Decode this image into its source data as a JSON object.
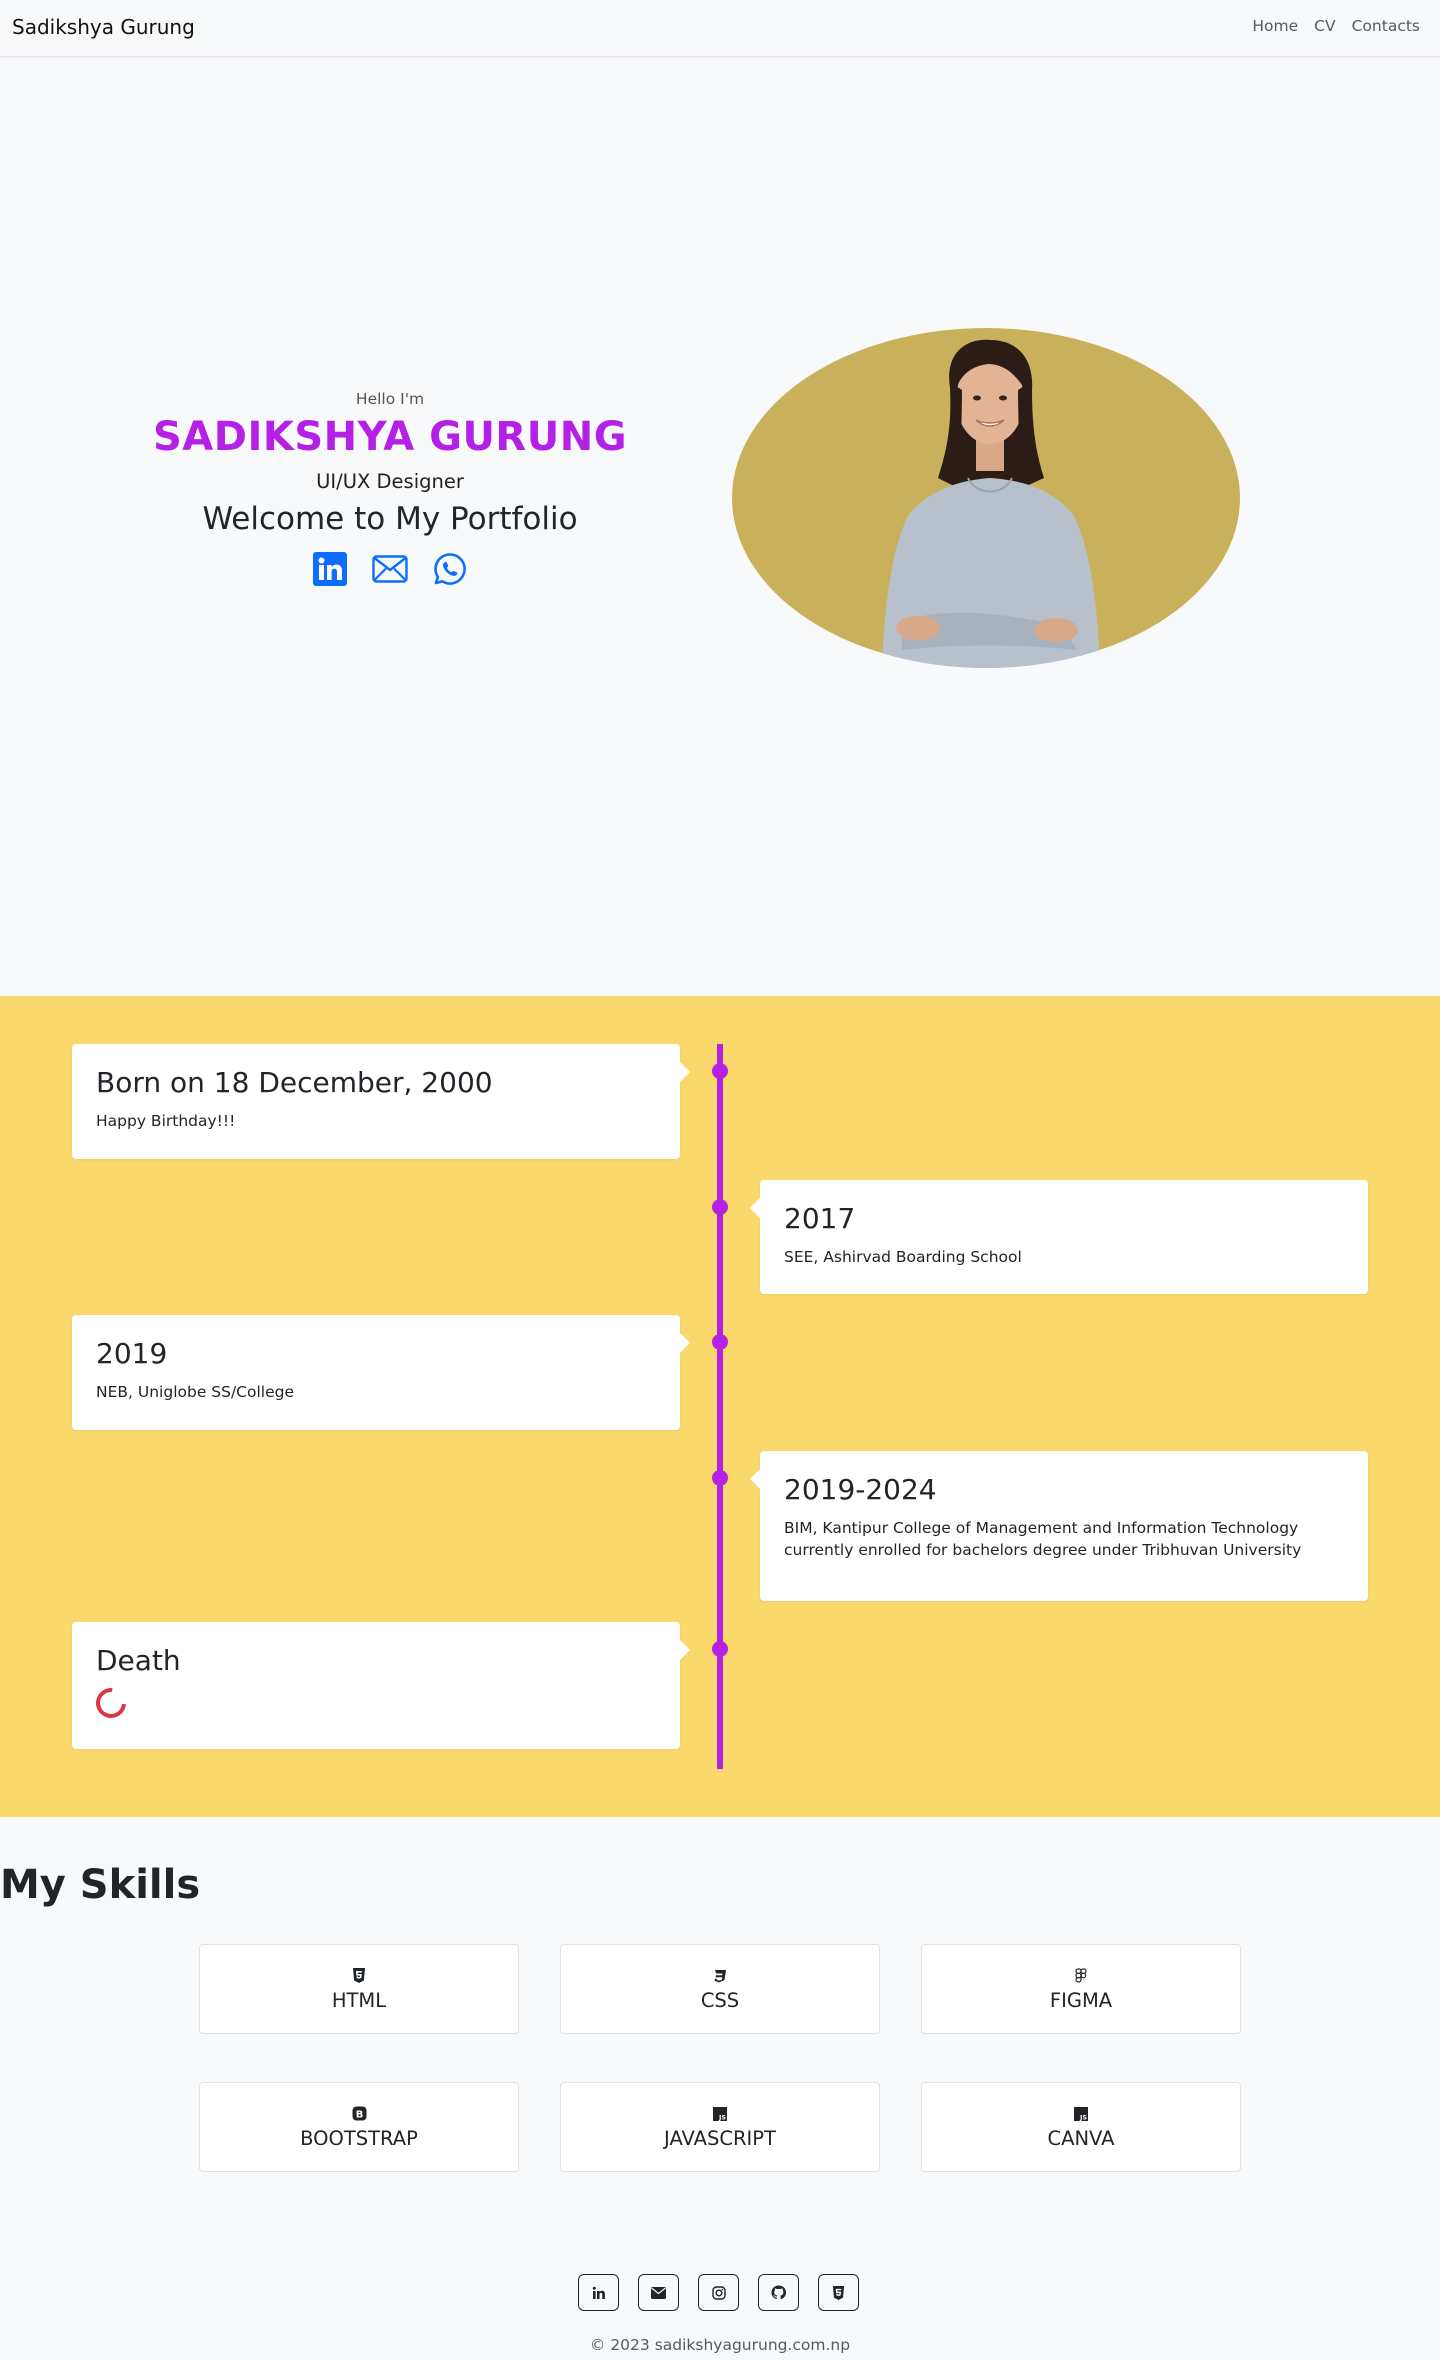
{
  "navbar": {
    "brand": "Sadikshya Gurung",
    "links": [
      "Home",
      "CV",
      "Contacts"
    ]
  },
  "hero": {
    "greeting": "Hello I'm",
    "name": "SADIKSHYA GURUNG",
    "role": "UI/UX Designer",
    "welcome": "Welcome to My Portfolio",
    "socials": [
      "linkedin-icon",
      "envelope-icon",
      "whatsapp-icon"
    ],
    "photo_background": "#c9b05b"
  },
  "timeline": {
    "background": "#f9d96c",
    "accent": "#b420e6",
    "events": [
      {
        "title": "Born on 18 December, 2000",
        "description": "Happy Birthday!!!"
      },
      {
        "title": "2017",
        "description": "SEE, Ashirvad Boarding School"
      },
      {
        "title": "2019",
        "description": "NEB, Uniglobe SS/College"
      },
      {
        "title": "2019-2024",
        "description": "BIM, Kantipur College of Management and Information Technology currently enrolled for bachelors degree under Tribhuvan University"
      },
      {
        "title": "Death",
        "description": ""
      }
    ]
  },
  "skills": {
    "title": "My Skills",
    "items": [
      {
        "name": "HTML",
        "icon": "html5-icon"
      },
      {
        "name": "CSS",
        "icon": "css3-icon"
      },
      {
        "name": "FIGMA",
        "icon": "figma-icon"
      },
      {
        "name": "BOOTSTRAP",
        "icon": "bootstrap-icon"
      },
      {
        "name": "JAVASCRIPT",
        "icon": "javascript-icon"
      },
      {
        "name": "CANVA",
        "icon": "canva-icon"
      }
    ]
  },
  "footer": {
    "icons": [
      "linkedin-icon",
      "envelope-icon",
      "instagram-icon",
      "github-icon",
      "html5-icon"
    ],
    "copyright": "© 2023 sadikshyagurung.com.np"
  }
}
